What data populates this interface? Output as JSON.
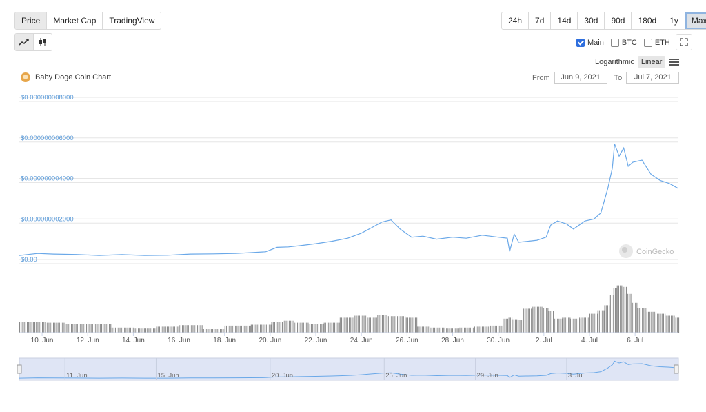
{
  "tabs": [
    {
      "label": "Price",
      "active": true
    },
    {
      "label": "Market Cap",
      "active": false
    },
    {
      "label": "TradingView",
      "active": false
    }
  ],
  "ranges": [
    {
      "label": "24h"
    },
    {
      "label": "7d"
    },
    {
      "label": "14d"
    },
    {
      "label": "30d"
    },
    {
      "label": "90d"
    },
    {
      "label": "180d"
    },
    {
      "label": "1y"
    },
    {
      "label": "Max",
      "selected": true
    }
  ],
  "chart_type_buttons": [
    {
      "icon": "line-chart-icon",
      "active": true
    },
    {
      "icon": "candlestick-chart-icon",
      "active": false
    }
  ],
  "compare": [
    {
      "label": "Main",
      "checked": true
    },
    {
      "label": "BTC",
      "checked": false
    },
    {
      "label": "ETH",
      "checked": false
    }
  ],
  "scale": {
    "log_label": "Logarithmic",
    "linear_label": "Linear",
    "active": "Linear"
  },
  "chart_title": "Baby Doge Coin Chart",
  "date_range": {
    "from_label": "From",
    "from_value": "Jun 9, 2021",
    "to_label": "To",
    "to_value": "Jul 7, 2021"
  },
  "watermark": "CoinGecko",
  "colors": {
    "line": "#6aa8e8",
    "accent_blue": "#2f6fde",
    "volume": "#8a8a8a",
    "navigator_fill": "#dfe5f5"
  },
  "chart_data": {
    "type": "line",
    "title": "Baby Doge Coin Chart",
    "x_unit": "days",
    "y_ticks": [
      "$0.00",
      "$0.000000002000",
      "$0.000000004000",
      "$0.000000006000",
      "$0.000000008000"
    ],
    "ylim": [
      0,
      8e-09
    ],
    "x_ticks": [
      {
        "label": "10. Jun",
        "day": 1
      },
      {
        "label": "12. Jun",
        "day": 3
      },
      {
        "label": "14. Jun",
        "day": 5
      },
      {
        "label": "16. Jun",
        "day": 7
      },
      {
        "label": "18. Jun",
        "day": 9
      },
      {
        "label": "20. Jun",
        "day": 11
      },
      {
        "label": "22. Jun",
        "day": 13
      },
      {
        "label": "24. Jun",
        "day": 15
      },
      {
        "label": "26. Jun",
        "day": 17
      },
      {
        "label": "28. Jun",
        "day": 19
      },
      {
        "label": "30. Jun",
        "day": 21
      },
      {
        "label": "2. Jul",
        "day": 23
      },
      {
        "label": "4. Jul",
        "day": 25
      },
      {
        "label": "6. Jul",
        "day": 27
      }
    ],
    "x": [
      0,
      0.8,
      1.5,
      2.5,
      3.5,
      4.5,
      5.5,
      6.5,
      7.5,
      8.5,
      9.5,
      10.8,
      11.3,
      11.8,
      12.3,
      13.0,
      13.7,
      14.4,
      15.0,
      15.5,
      15.9,
      16.3,
      16.7,
      17.2,
      17.7,
      18.3,
      19.0,
      19.6,
      20.3,
      21.0,
      21.4,
      21.5,
      21.7,
      21.9,
      22.3,
      22.7,
      23.1,
      23.3,
      23.6,
      24.0,
      24.3,
      24.8,
      25.2,
      25.5,
      25.8,
      26.0,
      26.1,
      26.3,
      26.5,
      26.7,
      26.9,
      27.3,
      27.7,
      28.1,
      28.5,
      28.9
    ],
    "y": [
      2e-10,
      3e-10,
      2.7e-10,
      2.5e-10,
      2e-10,
      2.4e-10,
      2e-10,
      2.1e-10,
      2.7e-10,
      2.8e-10,
      3e-10,
      3.8e-10,
      6e-10,
      6.2e-10,
      6.8e-10,
      7.8e-10,
      9e-10,
      1.05e-09,
      1.3e-09,
      1.6e-09,
      1.85e-09,
      1.95e-09,
      1.5e-09,
      1.1e-09,
      1.15e-09,
      1e-09,
      1.1e-09,
      1.05e-09,
      1.2e-09,
      1.1e-09,
      1.05e-09,
      4e-10,
      1.25e-09,
      8.5e-10,
      9e-10,
      9.5e-10,
      1.1e-09,
      1.7e-09,
      1.9e-09,
      1.75e-09,
      1.5e-09,
      1.9e-09,
      2e-09,
      2.3e-09,
      3.5e-09,
      4.5e-09,
      5.7e-09,
      5.1e-09,
      5.5e-09,
      4.6e-09,
      4.8e-09,
      4.9e-09,
      4.2e-09,
      3.9e-09,
      3.75e-09,
      3.5e-09
    ],
    "volume": [
      0.22,
      0.22,
      0.2,
      0.18,
      0.17,
      0.1,
      0.08,
      0.12,
      0.15,
      0.07,
      0.14,
      0.16,
      0.22,
      0.24,
      0.2,
      0.18,
      0.2,
      0.3,
      0.34,
      0.3,
      0.36,
      0.33,
      0.33,
      0.3,
      0.12,
      0.1,
      0.08,
      0.1,
      0.12,
      0.14,
      0.28,
      0.3,
      0.27,
      0.26,
      0.48,
      0.52,
      0.5,
      0.44,
      0.28,
      0.3,
      0.28,
      0.3,
      0.38,
      0.45,
      0.55,
      0.75,
      0.9,
      0.95,
      0.92,
      0.78,
      0.6,
      0.5,
      0.42,
      0.38,
      0.34,
      0.3
    ],
    "navigator_ticks": [
      {
        "label": "11. Jun",
        "day": 2
      },
      {
        "label": "15. Jun",
        "day": 6
      },
      {
        "label": "20. Jun",
        "day": 11
      },
      {
        "label": "25. Jun",
        "day": 16
      },
      {
        "label": "29. Jun",
        "day": 20
      },
      {
        "label": "3. Jul",
        "day": 24
      }
    ],
    "grid": true
  }
}
